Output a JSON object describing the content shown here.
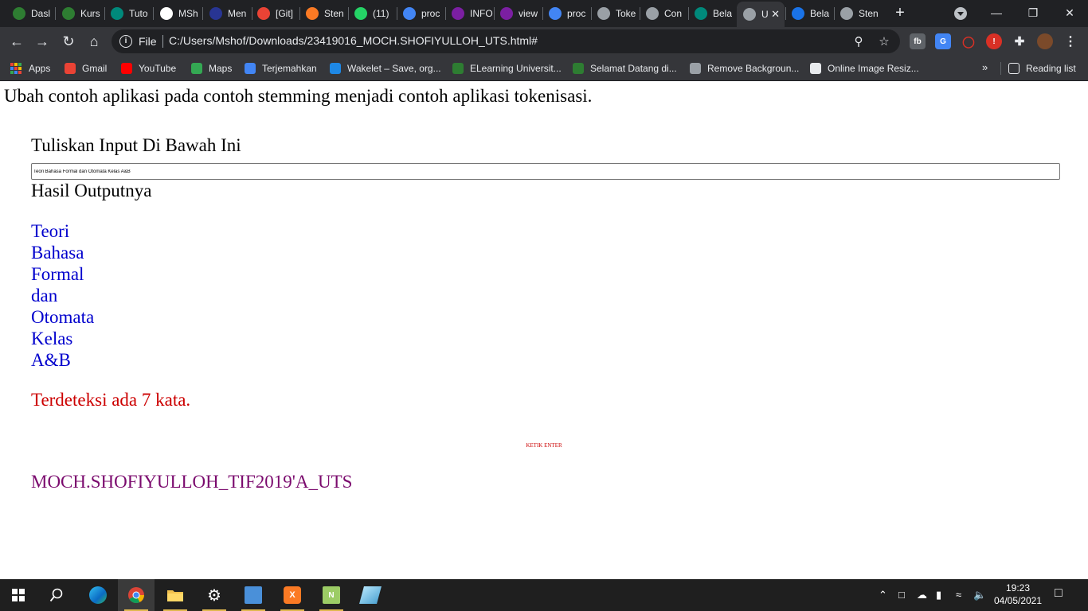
{
  "browser": {
    "tabs": [
      {
        "title": "Dasl",
        "icon": "moodle-icon",
        "color": "#2e7d32"
      },
      {
        "title": "Kurs",
        "icon": "moodle-icon",
        "color": "#2e7d32"
      },
      {
        "title": "Tuto",
        "icon": "teal-logo-icon",
        "color": "#00897b"
      },
      {
        "title": "MSh",
        "icon": "github-icon",
        "color": "#ffffff"
      },
      {
        "title": "Men",
        "icon": "v-logo-icon",
        "color": "#283593"
      },
      {
        "title": "[Git]",
        "icon": "gmail-icon",
        "color": "#ea4335"
      },
      {
        "title": "Sten",
        "icon": "xampp-icon",
        "color": "#fb7a24"
      },
      {
        "title": "(11)",
        "icon": "whatsapp-icon",
        "color": "#25d366"
      },
      {
        "title": "proc",
        "icon": "google-icon",
        "color": "#4285f4"
      },
      {
        "title": "INFO",
        "icon": "pinterest-like-icon",
        "color": "#7b1fa2"
      },
      {
        "title": "view",
        "icon": "pinterest-like-icon",
        "color": "#7b1fa2"
      },
      {
        "title": "proc",
        "icon": "google-icon",
        "color": "#4285f4"
      },
      {
        "title": "Toke",
        "icon": "globe-icon",
        "color": "#9aa0a6"
      },
      {
        "title": "Con",
        "icon": "globe-icon",
        "color": "#9aa0a6"
      },
      {
        "title": "Bela",
        "icon": "teal-logo-icon",
        "color": "#00897b"
      },
      {
        "title": "U",
        "icon": "globe-icon",
        "color": "#9aa0a6"
      },
      {
        "title": "Bela",
        "icon": "d-logo-icon",
        "color": "#1a73e8"
      },
      {
        "title": "Sten",
        "icon": "globe-icon",
        "color": "#9aa0a6"
      }
    ],
    "active_tab_index": 15,
    "new_tab_label": "+",
    "url_chip": "File",
    "url": "C:/Users/Mshof/Downloads/23419016_MOCH.SHOFIYULLOH_UTS.html#",
    "bookmarks": [
      {
        "label": "Apps",
        "icon": "apps-grid-icon",
        "color": "#ffffff"
      },
      {
        "label": "Gmail",
        "icon": "gmail-icon",
        "color": "#ea4335"
      },
      {
        "label": "YouTube",
        "icon": "youtube-icon",
        "color": "#ff0000"
      },
      {
        "label": "Maps",
        "icon": "maps-pin-icon",
        "color": "#34a853"
      },
      {
        "label": "Terjemahkan",
        "icon": "translate-icon",
        "color": "#4285f4"
      },
      {
        "label": "Wakelet – Save, org...",
        "icon": "wakelet-icon",
        "color": "#1e88e5"
      },
      {
        "label": "ELearning Universit...",
        "icon": "moodle-icon",
        "color": "#2e7d32"
      },
      {
        "label": "Selamat Datang di...",
        "icon": "moodle-icon",
        "color": "#2e7d32"
      },
      {
        "label": "Remove Backgroun...",
        "icon": "layers-icon",
        "color": "#9aa0a6"
      },
      {
        "label": "Online Image Resiz...",
        "icon": "globe-icon",
        "color": "#e8eaed"
      }
    ],
    "reading_list_label": "Reading list"
  },
  "page": {
    "instruction": "Ubah contoh aplikasi pada contoh stemming menjadi contoh aplikasi tokenisasi.",
    "input_heading": "Tuliskan Input Di Bawah Ini",
    "input_value": "Teori Bahasa Formal dan Otomata Kelas A&B",
    "output_heading": "Hasil Outputnya",
    "tokens": [
      "Teori",
      "Bahasa",
      "Formal",
      "dan",
      "Otomata",
      "Kelas",
      "A&B"
    ],
    "detect_text": "Terdeteksi ada 7 kata.",
    "enter_label": "KETIK ENTER",
    "signature": "MOCH.SHOFIYULLOH_TIF2019'A_UTS"
  },
  "taskbar": {
    "apps": [
      {
        "name": "search",
        "icon": "search-icon"
      },
      {
        "name": "edge",
        "icon": "edge-icon"
      },
      {
        "name": "chrome",
        "icon": "chrome-icon"
      },
      {
        "name": "file-explorer",
        "icon": "folder-icon"
      },
      {
        "name": "settings",
        "icon": "gear-icon"
      },
      {
        "name": "control-panel",
        "icon": "control-panel-icon"
      },
      {
        "name": "xampp",
        "icon": "xampp-icon"
      },
      {
        "name": "notepad-plus",
        "icon": "notepad-icon"
      },
      {
        "name": "app",
        "icon": "pen-icon"
      }
    ],
    "time": "19:23",
    "date": "04/05/2021"
  }
}
